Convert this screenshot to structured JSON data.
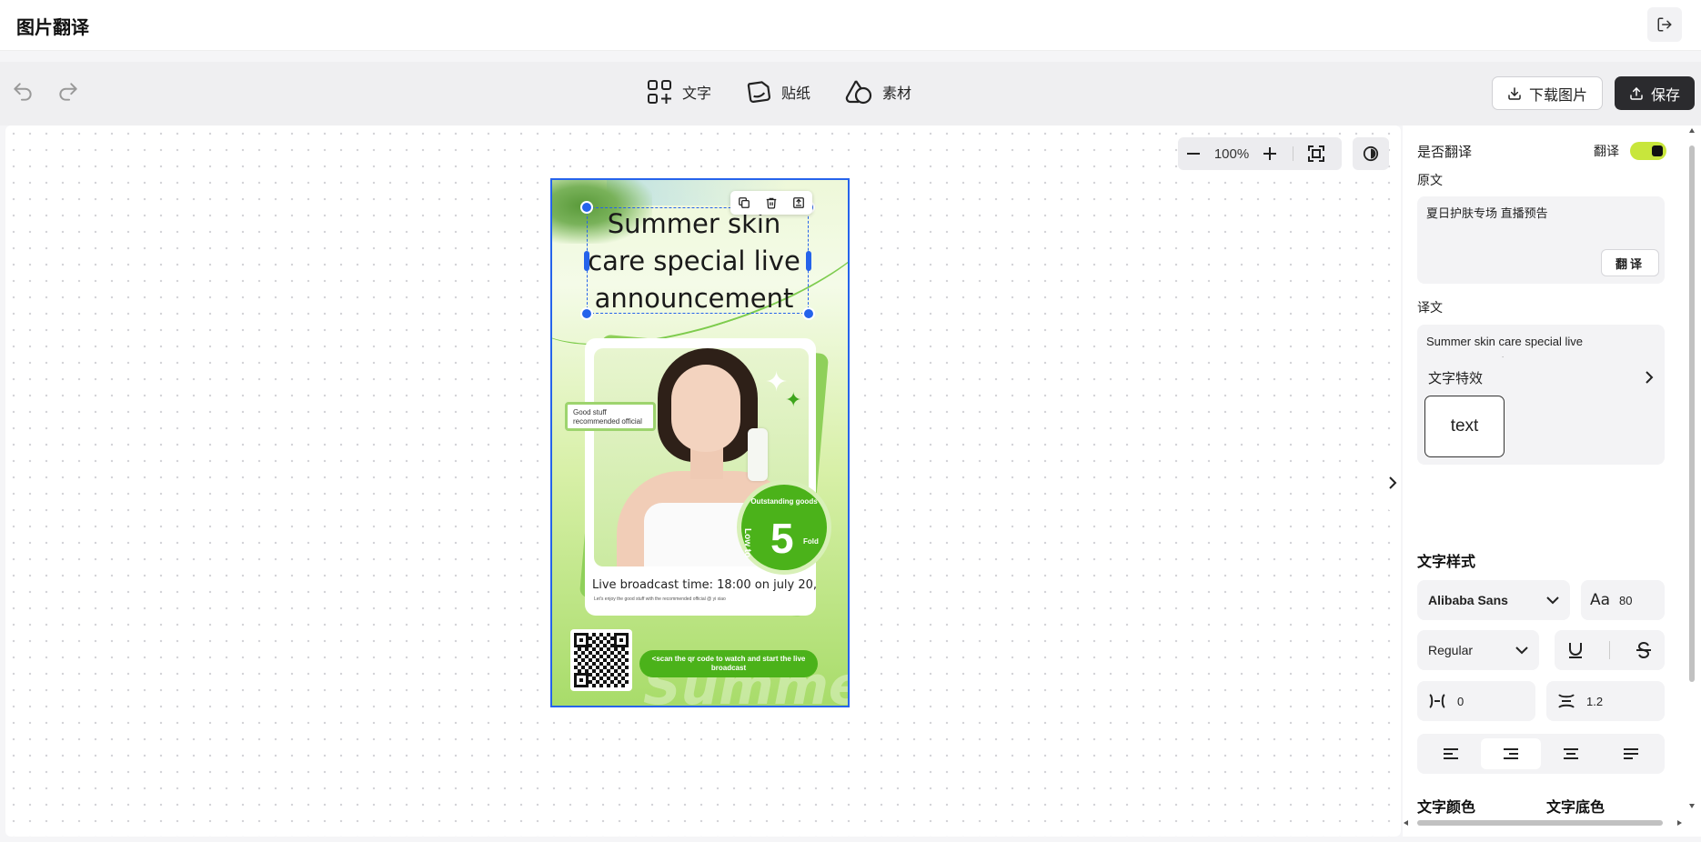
{
  "header": {
    "title": "图片翻译"
  },
  "toolbar": {
    "tools": [
      {
        "label": "文字",
        "icon": "add-text-icon"
      },
      {
        "label": "贴纸",
        "icon": "sticker-icon"
      },
      {
        "label": "素材",
        "icon": "material-icon"
      }
    ],
    "download_label": "下载图片",
    "save_label": "保存"
  },
  "zoom": {
    "value": "100%"
  },
  "poster": {
    "headline": "Summer skin care special live announcement",
    "tag_text": "Good stuff recommended official",
    "badge": {
      "top": "Outstanding goods",
      "low": "Low to",
      "number": "5",
      "unit": "Fold"
    },
    "live_time": "Live broadcast time: 18:00 on july 20,",
    "live_sub": "Let's enjoy the good stuff with the recommended official @ yi xiao",
    "scan_text": "<scan the qr code to watch and start the live broadcast",
    "watermark": "Summer",
    "colors": {
      "accent": "#4bb21a",
      "selection": "#2563eb"
    }
  },
  "panel": {
    "translate_question": "是否翻译",
    "toggle_label": "翻译",
    "toggle_on": true,
    "original_label": "原文",
    "original_text": "夏日护肤专场 直播预告",
    "translate_button": "翻译",
    "translation_label": "译文",
    "translation_text": "Summer skin care special live announcement",
    "effect_label": "文字特效",
    "effect_chip": "text",
    "style_label": "文字样式",
    "font_family": "Alibaba Sans",
    "font_size": "80",
    "font_weight": "Regular",
    "letter_spacing": "0",
    "line_height": "1.2",
    "color_label": "文字颜色",
    "bg_color_label": "文字底色",
    "alignment": "right",
    "toggle_color": "#c8e63c"
  }
}
